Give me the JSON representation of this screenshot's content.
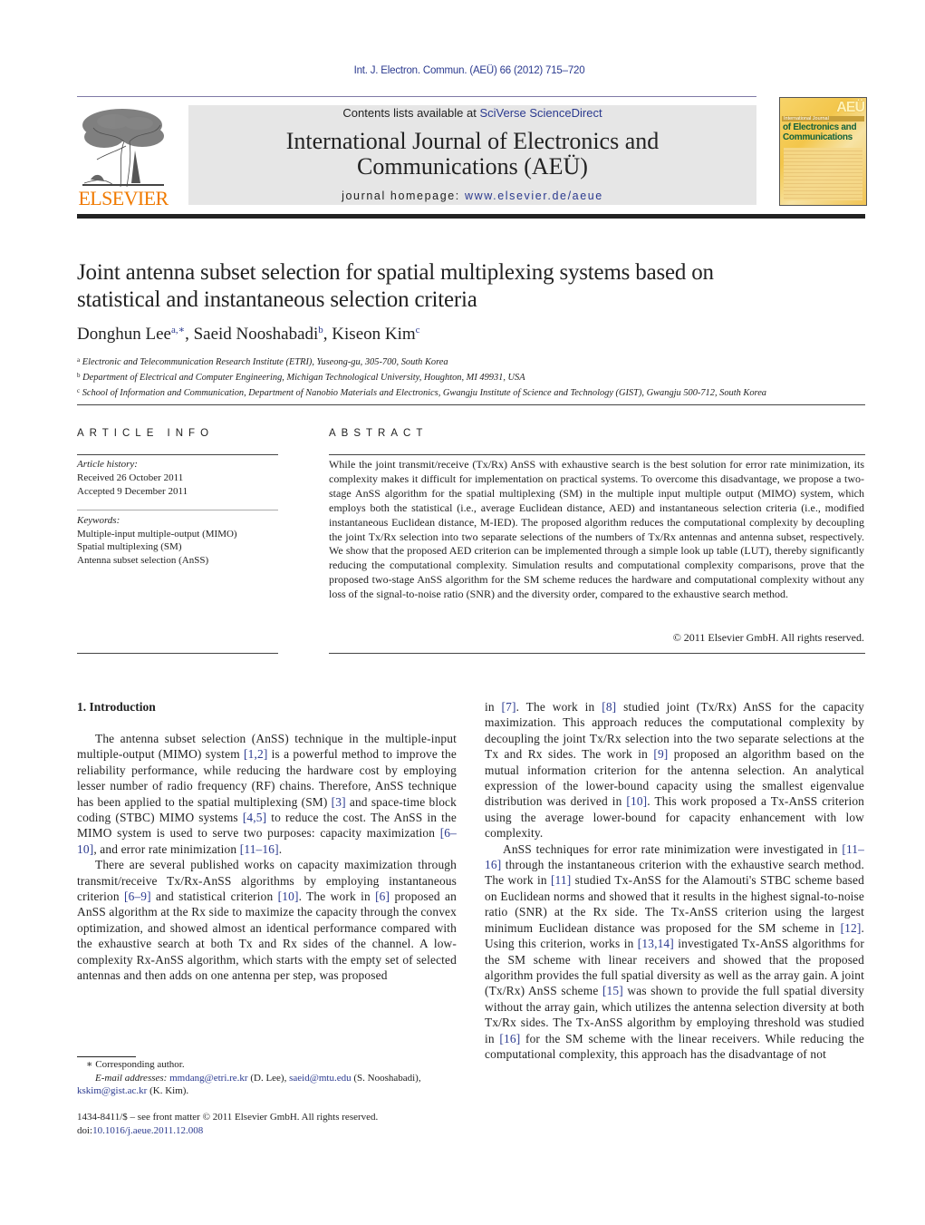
{
  "header": {
    "citation": "Int. J. Electron. Commun. (AEÜ) 66 (2012) 715–720",
    "contents_prefix": "Contents lists available at ",
    "contents_link": "SciVerse ScienceDirect",
    "journal_title_line1": "International Journal of Electronics and",
    "journal_title_line2": "Communications (AEÜ)",
    "homepage_prefix": "journal homepage: ",
    "homepage_link": "www.elsevier.de/aeue",
    "publisher_logo_text": "ELSEVIER",
    "cover": {
      "badge": "AEÜ",
      "band": "International Journal",
      "line1": "of Electronics and",
      "line2": "Communications"
    },
    "colors": {
      "link": "#2b3a8f",
      "elsevier_orange": "#f07a00",
      "masthead_bg": "#e6e6e6",
      "cover_green": "#14613a"
    }
  },
  "article": {
    "title_line1": "Joint antenna subset selection for spatial multiplexing systems based on",
    "title_line2": "statistical and instantaneous selection criteria",
    "authors": [
      {
        "name": "Donghun Lee",
        "sup": "a,∗"
      },
      {
        "name": "Saeid Nooshabadi",
        "sup": "b"
      },
      {
        "name": "Kiseon Kim",
        "sup": "c"
      }
    ],
    "affiliations": [
      {
        "mark": "a",
        "text": "Electronic and Telecommunication Research Institute (ETRI), Yuseong-gu, 305-700, South Korea"
      },
      {
        "mark": "b",
        "text": "Department of Electrical and Computer Engineering, Michigan Technological University, Houghton, MI 49931, USA"
      },
      {
        "mark": "c",
        "text": "School of Information and Communication, Department of Nanobio Materials and Electronics, Gwangju Institute of Science and Technology (GIST), Gwangju 500-712, South Korea"
      }
    ]
  },
  "article_info": {
    "heading": "ARTICLE INFO",
    "history_label": "Article history:",
    "received": "Received 26 October 2011",
    "accepted": "Accepted 9 December 2011",
    "keywords_label": "Keywords:",
    "keywords": [
      "Multiple-input multiple-output (MIMO)",
      "Spatial multiplexing (SM)",
      "Antenna subset selection (AnSS)"
    ]
  },
  "abstract": {
    "heading": "ABSTRACT",
    "text": "While the joint transmit/receive (Tx/Rx) AnSS with exhaustive search is the best solution for error rate minimization, its complexity makes it difficult for implementation on practical systems. To overcome this disadvantage, we propose a two-stage AnSS algorithm for the spatial multiplexing (SM) in the multiple input multiple output (MIMO) system, which employs both the statistical (i.e., average Euclidean distance, AED) and instantaneous selection criteria (i.e., modified instantaneous Euclidean distance, M-IED). The proposed algorithm reduces the computational complexity by decoupling the joint Tx/Rx selection into two separate selections of the numbers of Tx/Rx antennas and antenna subset, respectively. We show that the proposed AED criterion can be implemented through a simple look up table (LUT), thereby significantly reducing the computational complexity. Simulation results and computational complexity comparisons, prove that the proposed two-stage AnSS algorithm for the SM scheme reduces the hardware and computational complexity without any loss of the signal-to-noise ratio (SNR) and the diversity order, compared to the exhaustive search method.",
    "copyright": "© 2011 Elsevier GmbH. All rights reserved."
  },
  "intro": {
    "heading": "1.  Introduction",
    "p1": [
      "The antenna subset selection (AnSS) technique in the multiple-input multiple-output (MIMO) system ",
      "[1,2]",
      " is a powerful method to improve the reliability performance, while reducing the hardware cost by employing lesser number of radio frequency (RF) chains. Therefore, AnSS technique has been applied to the spatial multiplexing (SM) ",
      "[3]",
      " and space-time block coding (STBC) MIMO systems ",
      "[4,5]",
      " to reduce the cost. The AnSS in the MIMO system is used to serve two purposes: capacity maximization ",
      "[6–10]",
      ", and error rate minimization ",
      "[11–16]",
      "."
    ],
    "p2": [
      "There are several published works on capacity maximization through transmit/receive Tx/Rx-AnSS algorithms by employing instantaneous criterion ",
      "[6–9]",
      " and statistical criterion ",
      "[10]",
      ". The work in ",
      "[6]",
      " proposed an AnSS algorithm at the Rx side to maximize the capacity through the convex optimization, and showed almost an identical performance compared with the exhaustive search at both Tx and Rx sides of the channel. A low-complexity Rx-AnSS algorithm, which starts with the empty set of selected antennas and then adds on one antenna per step, was proposed"
    ],
    "p2_cont": [
      "in ",
      "[7]",
      ". The work in ",
      "[8]",
      " studied joint (Tx/Rx) AnSS for the capacity maximization. This approach reduces the computational complexity by decoupling the joint Tx/Rx selection into the two separate selections at the Tx and Rx sides. The work in ",
      "[9]",
      " proposed an algorithm based on the mutual information criterion for the antenna selection. An analytical expression of the lower-bound capacity using the smallest eigenvalue distribution was derived in ",
      "[10]",
      ". This work proposed a Tx-AnSS criterion using the average lower-bound for capacity enhancement with low complexity."
    ],
    "p3": [
      "AnSS techniques for error rate minimization were investigated in ",
      "[11–16]",
      " through the instantaneous criterion with the exhaustive search method. The work in ",
      "[11]",
      " studied Tx-AnSS for the Alamouti's STBC scheme based on Euclidean norms and showed that it results in the highest signal-to-noise ratio (SNR) at the Rx side. The Tx-AnSS criterion using the largest minimum Euclidean distance was proposed for the SM scheme in ",
      "[12]",
      ". Using this criterion, works in ",
      "[13,14]",
      " investigated Tx-AnSS algorithms for the SM scheme with linear receivers and showed that the proposed algorithm provides the full spatial diversity as well as the array gain. A joint (Tx/Rx) AnSS scheme ",
      "[15]",
      " was shown to provide the full spatial diversity without the array gain, which utilizes the antenna selection diversity at both Tx/Rx sides. The Tx-AnSS algorithm by employing threshold was studied in ",
      "[16]",
      " for the SM scheme with the linear receivers. While reducing the computational complexity, this approach has the disadvantage of not"
    ]
  },
  "footnotes": {
    "corresponding": "∗ Corresponding author.",
    "email_label": "E-mail addresses: ",
    "emails": [
      {
        "addr": "mmdang@etri.re.kr",
        "who": " (D. Lee), "
      },
      {
        "addr": "saeid@mtu.edu",
        "who": " (S. Nooshabadi), "
      },
      {
        "addr": "kskim@gist.ac.kr",
        "who": " (K. Kim)."
      }
    ],
    "issn": "1434-8411/$ – see front matter © 2011 Elsevier GmbH. All rights reserved.",
    "doi_prefix": "doi:",
    "doi": "10.1016/j.aeue.2011.12.008"
  }
}
